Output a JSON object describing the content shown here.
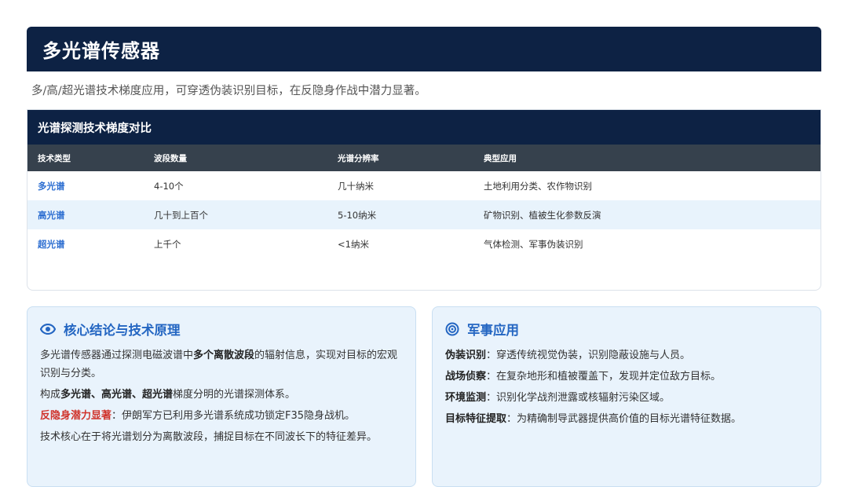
{
  "header": {
    "title": "多光谱传感器"
  },
  "subtitle": "多/高/超光谱技术梯度应用，可穿透伪装识别目标，在反隐身作战中潜力显著。",
  "table": {
    "title": "光谱探测技术梯度对比",
    "headers": [
      "技术类型",
      "波段数量",
      "光谱分辨率",
      "典型应用"
    ],
    "rows": [
      [
        "多光谱",
        "4-10个",
        "几十纳米",
        "土地利用分类、农作物识别"
      ],
      [
        "高光谱",
        "几十到上百个",
        "5-10纳米",
        "矿物识别、植被生化参数反演"
      ],
      [
        "超光谱",
        "上千个",
        "<1纳米",
        "气体检测、军事伪装识别"
      ]
    ]
  },
  "left_card": {
    "title": "核心结论与技术原理",
    "icon": "eye-icon",
    "p1_a": "多光谱传感器通过探测电磁波谱中",
    "p1_b": "多个离散波段",
    "p1_c": "的辐射信息，实现对目标的宏观识别与分类。",
    "p2_a": "构成",
    "p2_b": "多光谱、高光谱、超光谱",
    "p2_c": "梯度分明的光谱探测体系。",
    "p3_a": "反隐身潜力显著",
    "p3_b": "：伊朗军方已利用多光谱系统成功锁定F35隐身战机。",
    "p4": "技术核心在于将光谱划分为离散波段，捕捉目标在不同波长下的特征差异。"
  },
  "right_card": {
    "title": "军事应用",
    "icon": "target-icon",
    "items": [
      {
        "term": "伪装识别",
        "desc": "：穿透传统视觉伪装，识别隐蔽设施与人员。"
      },
      {
        "term": "战场侦察",
        "desc": "：在复杂地形和植被覆盖下，发现并定位敌方目标。"
      },
      {
        "term": "环境监测",
        "desc": "：识别化学战剂泄露或核辐射污染区域。"
      },
      {
        "term": "目标特征提取",
        "desc": "：为精确制导武器提供高价值的目标光谱特征数据。"
      }
    ]
  },
  "colors": {
    "navy": "#0d2244",
    "accent_blue": "#2466c2",
    "warning_red": "#d0342c",
    "card_bg": "#e9f3fc"
  }
}
